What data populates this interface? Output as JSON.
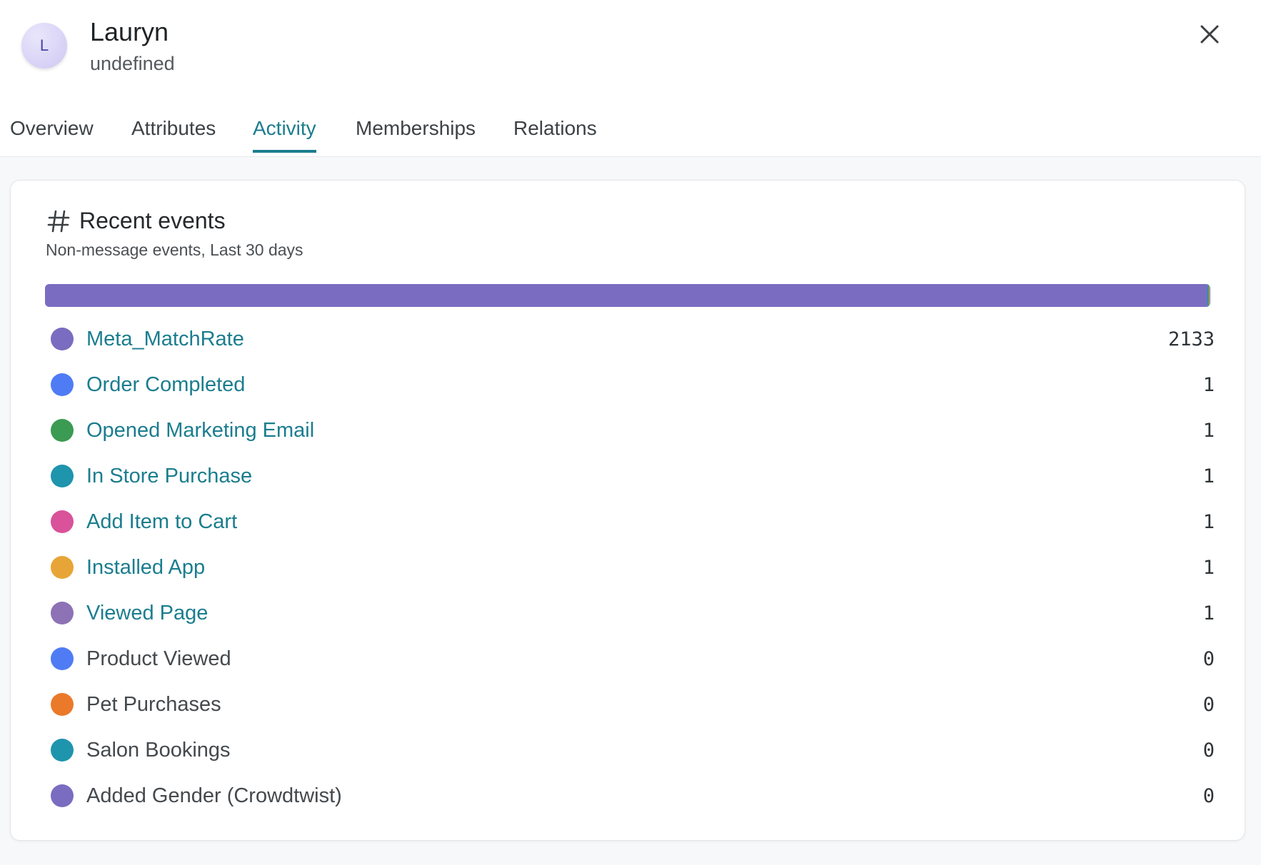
{
  "profile": {
    "initial": "L",
    "name": "Lauryn",
    "subtitle": "undefined"
  },
  "tabs": [
    {
      "label": "Overview",
      "active": false
    },
    {
      "label": "Attributes",
      "active": false
    },
    {
      "label": "Activity",
      "active": true
    },
    {
      "label": "Memberships",
      "active": false
    },
    {
      "label": "Relations",
      "active": false
    }
  ],
  "recent_events": {
    "title": "Recent events",
    "subtitle": "Non-message events, Last 30 days",
    "events": [
      {
        "name": "Meta_MatchRate",
        "count": 2133,
        "color": "#7a6cc0",
        "link": true
      },
      {
        "name": "Order Completed",
        "count": 1,
        "color": "#4f7cf5",
        "link": true
      },
      {
        "name": "Opened Marketing Email",
        "count": 1,
        "color": "#3b9b52",
        "link": true
      },
      {
        "name": "In Store Purchase",
        "count": 1,
        "color": "#1f94ad",
        "link": true
      },
      {
        "name": "Add Item to Cart",
        "count": 1,
        "color": "#d9529a",
        "link": true
      },
      {
        "name": "Installed App",
        "count": 1,
        "color": "#e8a537",
        "link": true
      },
      {
        "name": "Viewed Page",
        "count": 1,
        "color": "#8d72b5",
        "link": true
      },
      {
        "name": "Product Viewed",
        "count": 0,
        "color": "#4f7cf5",
        "link": false
      },
      {
        "name": "Pet Purchases",
        "count": 0,
        "color": "#ea7a2a",
        "link": false
      },
      {
        "name": "Salon Bookings",
        "count": 0,
        "color": "#1f94ad",
        "link": false
      },
      {
        "name": "Added Gender (Crowdtwist)",
        "count": 0,
        "color": "#7a6cc0",
        "link": false
      }
    ]
  }
}
